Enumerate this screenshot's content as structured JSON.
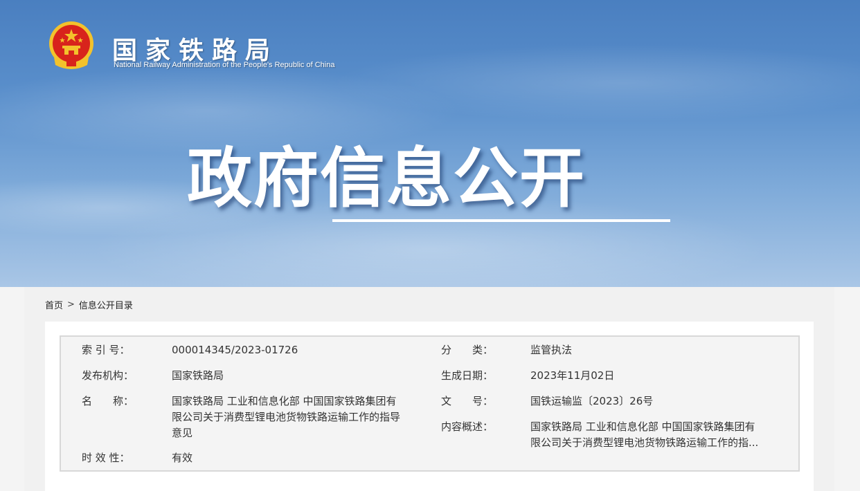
{
  "header": {
    "org_name_cn": "国家铁路局",
    "org_name_en": "National Railway Administration of the People's Republic of China",
    "emblem_icon": "national-emblem-icon",
    "hero_title": "政府信息公开"
  },
  "breadcrumb": {
    "home": "首页",
    "separator": ">",
    "current": "信息公开目录"
  },
  "meta": {
    "index_label": "索 引 号：",
    "index_value": "000014345/2023-01726",
    "category_label": "分　　类：",
    "category_value": "监管执法",
    "issuer_label": "发布机构：",
    "issuer_value": "国家铁路局",
    "date_label": "生成日期：",
    "date_value": "2023年11月02日",
    "name_label": "名　　称：",
    "name_value_line1": "国家铁路局 工业和信息化部 中国国家铁路集团有",
    "name_value_line2": "限公司关于消费型锂电池货物铁路运输工作的指导",
    "name_value_line3": "意见",
    "docno_label": "文　　号：",
    "docno_value": "国铁运输监〔2023〕26号",
    "summary_label": "内容概述：",
    "summary_value_line1": "国家铁路局 工业和信息化部 中国国家铁路集团有",
    "summary_value_line2": "限公司关于消费型锂电池货物铁路运输工作的指...",
    "validity_label": "时 效 性：",
    "validity_value": "有效"
  },
  "colors": {
    "banner_top": "#4a7fc0",
    "banner_bottom": "#a9c6e6",
    "emblem_red": "#d8231c",
    "emblem_gold": "#f3c22c"
  }
}
